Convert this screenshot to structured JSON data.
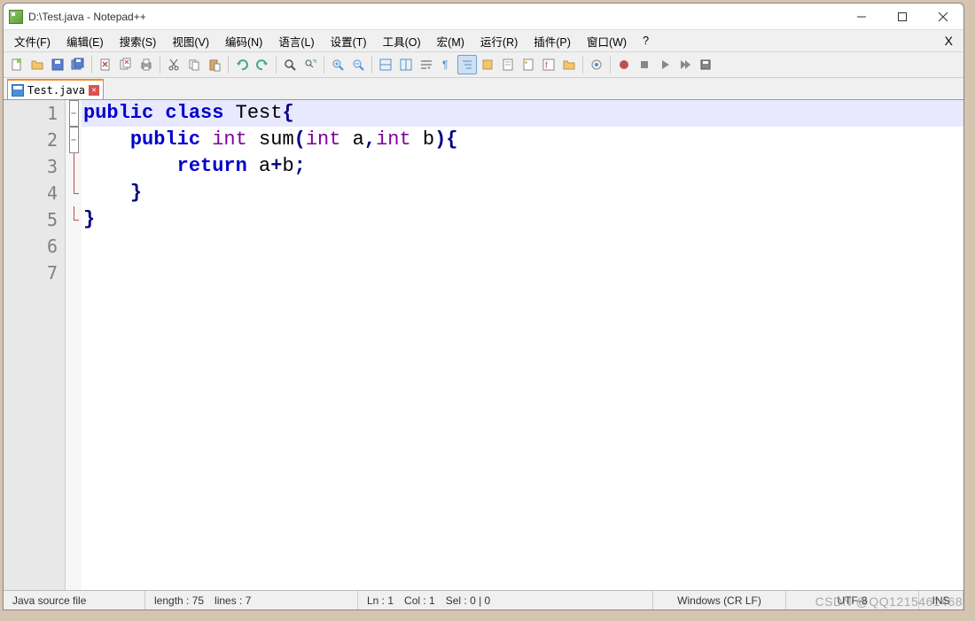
{
  "window": {
    "title": "D:\\Test.java - Notepad++"
  },
  "menu": {
    "items": [
      "文件(F)",
      "编辑(E)",
      "搜索(S)",
      "视图(V)",
      "编码(N)",
      "语言(L)",
      "设置(T)",
      "工具(O)",
      "宏(M)",
      "运行(R)",
      "插件(P)",
      "窗口(W)",
      "?"
    ]
  },
  "tab": {
    "label": "Test.java"
  },
  "code": {
    "lines": [
      {
        "n": "1",
        "html": "<span class='kw'>public</span> <span class='kw'>class</span> <span class='cls'>Test</span><span class='punc'>{</span>",
        "cur": true,
        "fold": "minus"
      },
      {
        "n": "2",
        "html": "    <span class='kw'>public</span> <span class='type'>int</span> sum<span class='punc'>(</span><span class='type'>int</span> a<span class='punc'>,</span><span class='type'>int</span> b<span class='punc'>){</span>",
        "fold": "minus"
      },
      {
        "n": "3",
        "html": "        <span class='kw'>return</span> a<span class='punc'>+</span>b<span class='punc'>;</span>",
        "fold": "line"
      },
      {
        "n": "4",
        "html": "    <span class='punc'>}</span>",
        "fold": "end"
      },
      {
        "n": "5",
        "html": "<span class='punc'>}</span>",
        "fold": "end"
      },
      {
        "n": "6",
        "html": "",
        "fold": ""
      },
      {
        "n": "7",
        "html": "",
        "fold": ""
      }
    ]
  },
  "status": {
    "filetype": "Java source file",
    "length": "length : 75",
    "lines": "lines : 7",
    "ln": "Ln : 1",
    "col": "Col : 1",
    "sel": "Sel : 0 | 0",
    "eol": "Windows (CR LF)",
    "enc": "UTF-8",
    "mode": "INS"
  },
  "watermark": "CSDN @QQ1215461468"
}
